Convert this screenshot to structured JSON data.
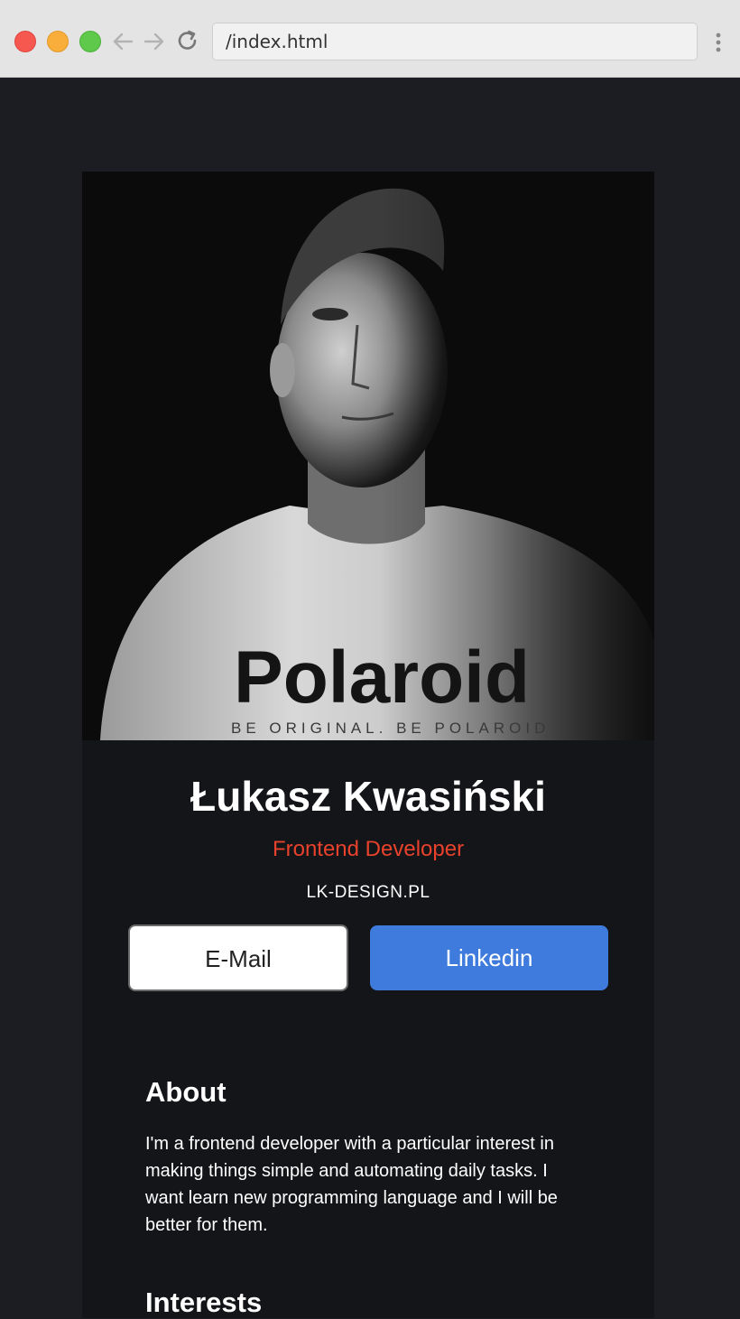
{
  "browser": {
    "url": "/index.html"
  },
  "profile": {
    "name": "Łukasz Kwasiński",
    "role": "Frontend Developer",
    "website": "LK-DESIGN.PL",
    "photo_shirt_text": "Polaroid",
    "photo_shirt_subtext": "BE ORIGINAL. BE POLAROID"
  },
  "buttons": {
    "email_label": "E-Mail",
    "linkedin_label": "Linkedin"
  },
  "about": {
    "title": "About",
    "text": "I'm a frontend developer with a particular interest in making things simple and automating daily tasks. I want learn new programming language and I will be better for them."
  },
  "interests": {
    "title": "Interests"
  },
  "colors": {
    "page_bg": "#1b1d22",
    "card_bg": "#141518",
    "accent_role": "#e8422c",
    "linkedin_blue": "#3e7bdc"
  }
}
